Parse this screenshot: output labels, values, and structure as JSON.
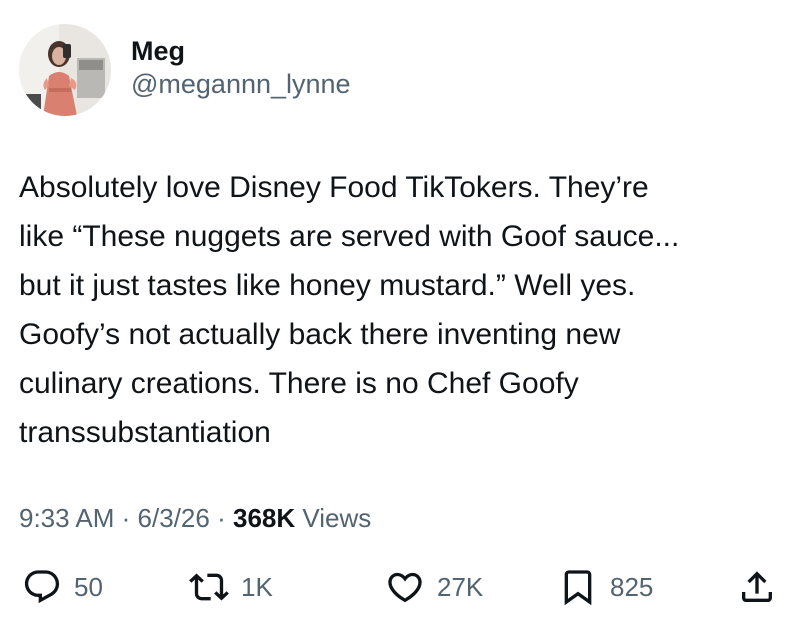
{
  "tweet": {
    "author": {
      "display_name": "Meg",
      "handle": "@megannn_lynne"
    },
    "text": "Absolutely love Disney Food TikTokers. They’re\nlike “These nuggets are served with Goof sauce...\nbut it just tastes like honey mustard.” Well yes.\nGoofy’s not actually back there inventing new\nculinary creations. There is no Chef Goofy\ntranssubstantiation",
    "time": "9:33 AM",
    "separator": "·",
    "date": "6/3/26",
    "views_count": "368K",
    "views_label": "Views"
  },
  "actions": {
    "reply": {
      "icon": "reply-icon",
      "count": "50"
    },
    "retweet": {
      "icon": "retweet-icon",
      "count": "1K"
    },
    "like": {
      "icon": "heart-icon",
      "count": "27K"
    },
    "bookmark": {
      "icon": "bookmark-icon",
      "count": "825"
    },
    "share": {
      "icon": "share-icon"
    }
  },
  "colors": {
    "text_primary": "#0f1419",
    "text_secondary": "#536471",
    "background": "#ffffff"
  }
}
